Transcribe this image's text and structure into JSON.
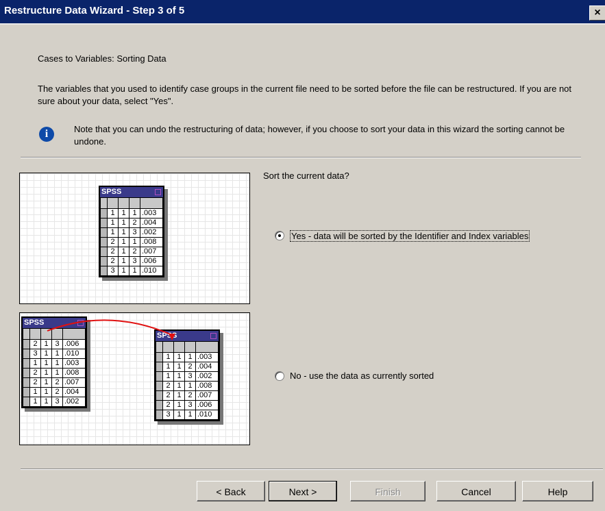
{
  "window": {
    "title": "Restructure Data Wizard - Step 3 of 5",
    "close_glyph": "×"
  },
  "heading": "Cases to Variables: Sorting Data",
  "intro_text": "The variables that you used to identify case groups in the current file need to be sorted before the file can be restructured.  If you are not sure about your data, select \"Yes\".",
  "note": {
    "icon": "info-icon",
    "icon_glyph": "i",
    "text": "Note that you can undo the restructuring of data; however, if you choose to sort your data in this wizard the sorting cannot be undone."
  },
  "illustration": {
    "window_label": "SPSS",
    "sorted_rows": [
      [
        "1",
        "1",
        "1",
        ".003"
      ],
      [
        "1",
        "1",
        "2",
        ".004"
      ],
      [
        "1",
        "1",
        "3",
        ".002"
      ],
      [
        "2",
        "1",
        "1",
        ".008"
      ],
      [
        "2",
        "1",
        "2",
        ".007"
      ],
      [
        "2",
        "1",
        "3",
        ".006"
      ],
      [
        "3",
        "1",
        "1",
        ".010"
      ]
    ],
    "unsorted_rows": [
      [
        "2",
        "1",
        "3",
        ".006"
      ],
      [
        "3",
        "1",
        "1",
        ".010"
      ],
      [
        "1",
        "1",
        "1",
        ".003"
      ],
      [
        "2",
        "1",
        "1",
        ".008"
      ],
      [
        "2",
        "1",
        "2",
        ".007"
      ],
      [
        "1",
        "1",
        "2",
        ".004"
      ],
      [
        "1",
        "1",
        "3",
        ".002"
      ]
    ],
    "arrow_color": "#e01010"
  },
  "sort_question": "Sort the current data?",
  "options": [
    {
      "label": "Yes - data will be sorted by the Identifier and Index variables",
      "selected": true
    },
    {
      "label": "No - use the data as currently sorted",
      "selected": false
    }
  ],
  "buttons": {
    "back": "< Back",
    "next": "Next >",
    "finish": "Finish",
    "cancel": "Cancel",
    "help": "Help"
  }
}
